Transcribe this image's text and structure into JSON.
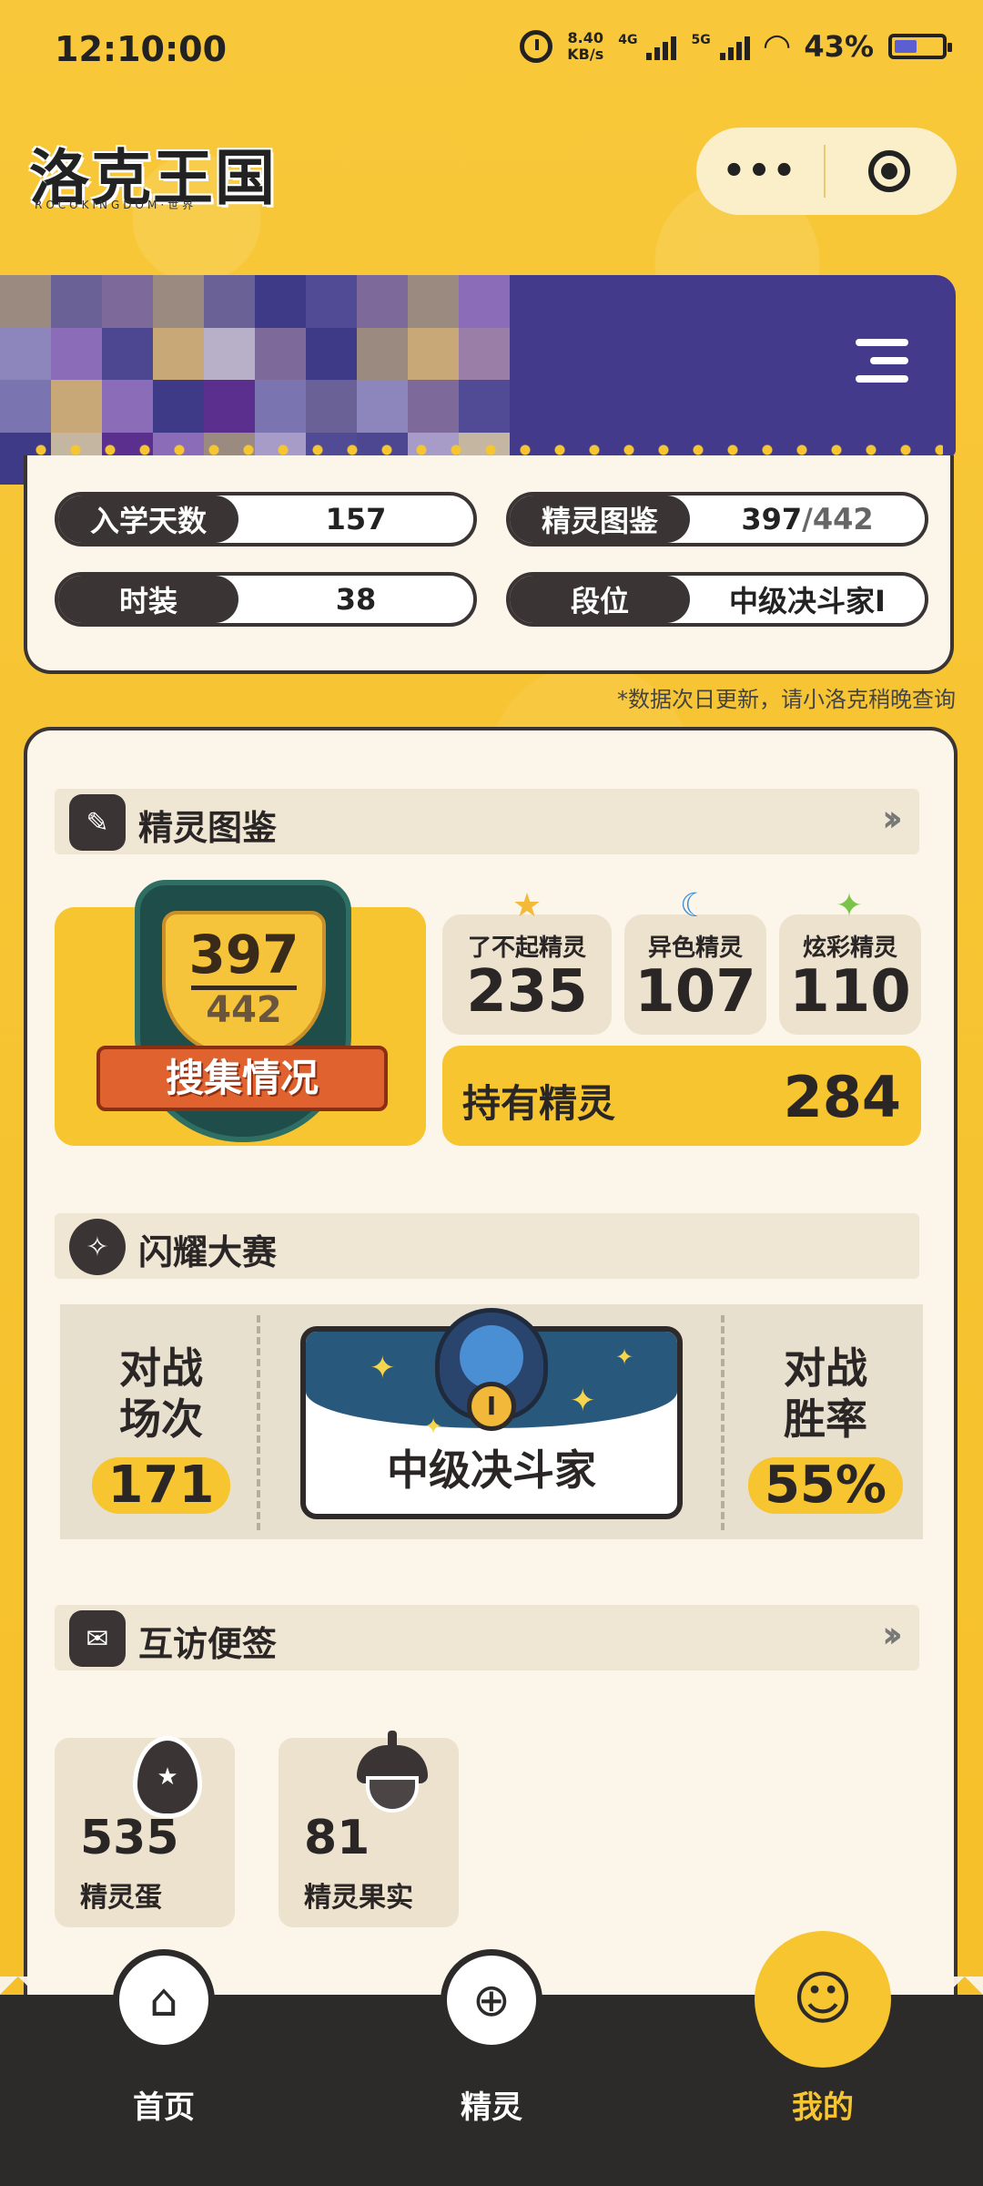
{
  "status_bar": {
    "time": "12:10:00",
    "speed_value": "8.40",
    "speed_unit": "KB/s",
    "net1": "4G",
    "net2": "5G",
    "battery_pct": "43%"
  },
  "header": {
    "logo": "洛克王国",
    "logo_sub": "ROCOKINGDOM·世界",
    "capsule_more": "•••",
    "colors": {
      "brand": "#f6c52f",
      "banner": "#433a8c",
      "dark": "#3a3434"
    }
  },
  "profile_stats": [
    {
      "label": "入学天数",
      "value": "157"
    },
    {
      "label": "精灵图鉴",
      "value": "397",
      "total": "/442"
    },
    {
      "label": "时装",
      "value": "38"
    },
    {
      "label": "段位",
      "value": "中级决斗家Ⅰ"
    }
  ],
  "update_note": "*数据次日更新，请小洛克稍晚查询",
  "pokedex": {
    "title": "精灵图鉴",
    "trophy_collected": "397",
    "trophy_total": "442",
    "ribbon": "搜集情况",
    "cards": [
      {
        "label": "了不起精灵",
        "value": "235",
        "icon": "star-icon"
      },
      {
        "label": "异色精灵",
        "value": "107",
        "icon": "moon-icon"
      },
      {
        "label": "炫彩精灵",
        "value": "110",
        "icon": "rainbow-star-icon"
      }
    ],
    "owned_label": "持有精灵",
    "owned_value": "284"
  },
  "contest": {
    "title": "闪耀大赛",
    "battles_label": "对战\n场次",
    "battles_value": "171",
    "rank_name": "中级决斗家",
    "rank_badge": "Ⅰ",
    "winrate_label": "对战\n胜率",
    "winrate_value": "55%"
  },
  "notes": {
    "title": "互访便签",
    "items": [
      {
        "value": "535",
        "label": "精灵蛋",
        "icon": "egg-icon"
      },
      {
        "value": "81",
        "label": "精灵果实",
        "icon": "acorn-icon"
      }
    ]
  },
  "nav": {
    "items": [
      {
        "label": "首页",
        "icon": "home-icon"
      },
      {
        "label": "精灵",
        "icon": "spirit-bag-icon"
      },
      {
        "label": "我的",
        "icon": "profile-icon",
        "active": true
      }
    ]
  }
}
